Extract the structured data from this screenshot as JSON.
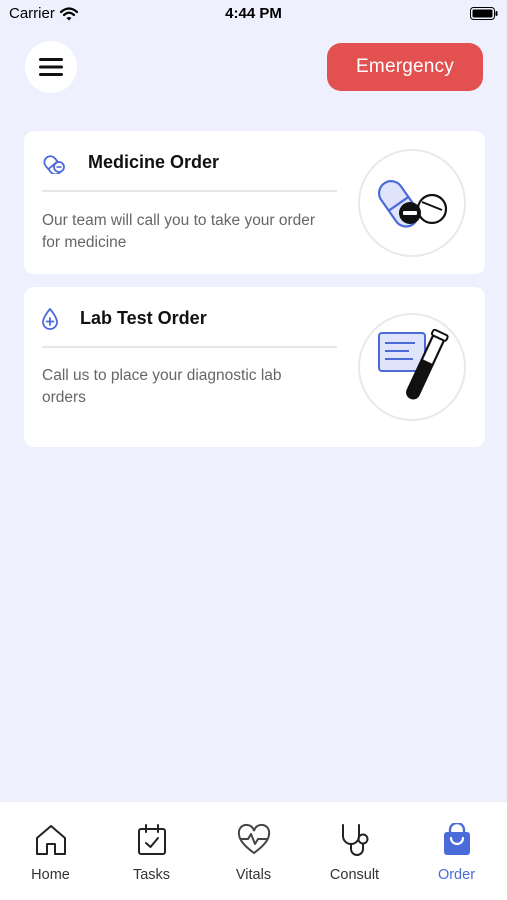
{
  "status_bar": {
    "carrier": "Carrier",
    "time": "4:44 PM"
  },
  "header": {
    "menu_icon": "hamburger-menu-icon",
    "emergency_label": "Emergency"
  },
  "cards": [
    {
      "title": "Medicine Order",
      "description": "Our team will call you to take your order for medicine",
      "icon": "pill-icon",
      "illustration": "capsule-tablet-illustration"
    },
    {
      "title": "Lab Test Order",
      "description": "Call us to place your diagnostic lab orders",
      "icon": "blood-drop-icon",
      "illustration": "test-tube-report-illustration"
    }
  ],
  "bottom_nav": {
    "items": [
      {
        "label": "Home",
        "icon": "home-icon",
        "active": false
      },
      {
        "label": "Tasks",
        "icon": "calendar-check-icon",
        "active": false
      },
      {
        "label": "Vitals",
        "icon": "heart-pulse-icon",
        "active": false
      },
      {
        "label": "Consult",
        "icon": "stethoscope-icon",
        "active": false
      },
      {
        "label": "Order",
        "icon": "shopping-bag-icon",
        "active": true
      }
    ]
  },
  "colors": {
    "background": "#eff0fd",
    "emergency": "#e35050",
    "accent": "#4a6bd8",
    "card_text": "#666666"
  }
}
